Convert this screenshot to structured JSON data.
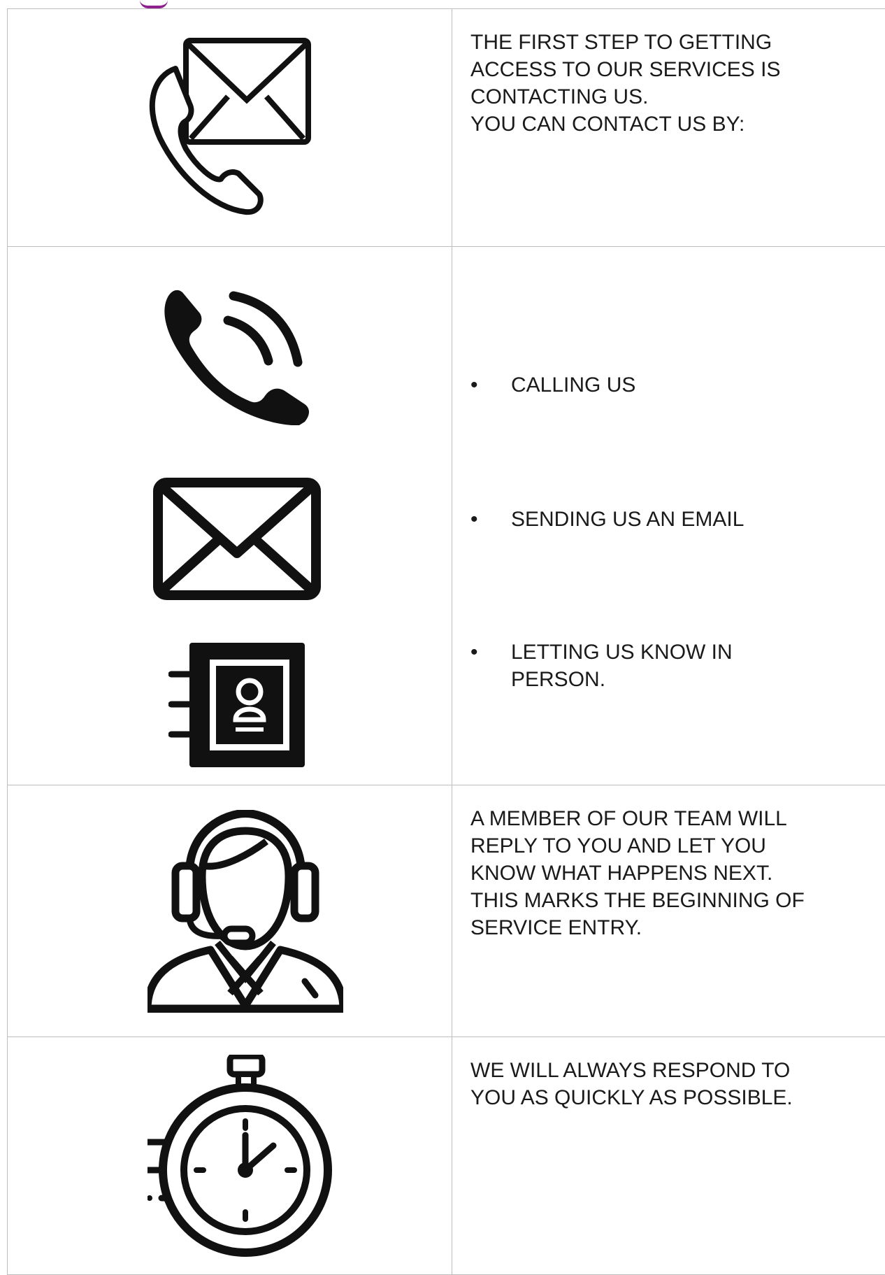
{
  "rows": [
    {
      "icon": "phone-and-envelope-icon",
      "lines": [
        "THE FIRST STEP TO GETTING",
        "ACCESS TO OUR SERVICES IS",
        "CONTACTING US.",
        "YOU CAN CONTACT US BY:"
      ]
    },
    {
      "icons": [
        "phone-ringing-icon",
        "envelope-icon",
        "contact-book-icon"
      ],
      "bullets": [
        "CALLING US",
        "SENDING US AN EMAIL",
        "LETTING US KNOW IN PERSON."
      ]
    },
    {
      "icon": "customer-support-agent-icon",
      "lines": [
        "A MEMBER OF OUR TEAM WILL",
        "REPLY TO YOU AND LET YOU",
        "KNOW WHAT HAPPENS NEXT.",
        "THIS MARKS THE BEGINNING OF",
        "SERVICE ENTRY."
      ]
    },
    {
      "icon": "fast-stopwatch-icon",
      "lines": [
        "WE WILL ALWAYS RESPOND TO",
        "YOU AS QUICKLY AS POSSIBLE."
      ]
    }
  ],
  "colors": {
    "border": "#bdbdbd",
    "text": "#1a1a1a",
    "accent": "#8e1f8c"
  }
}
